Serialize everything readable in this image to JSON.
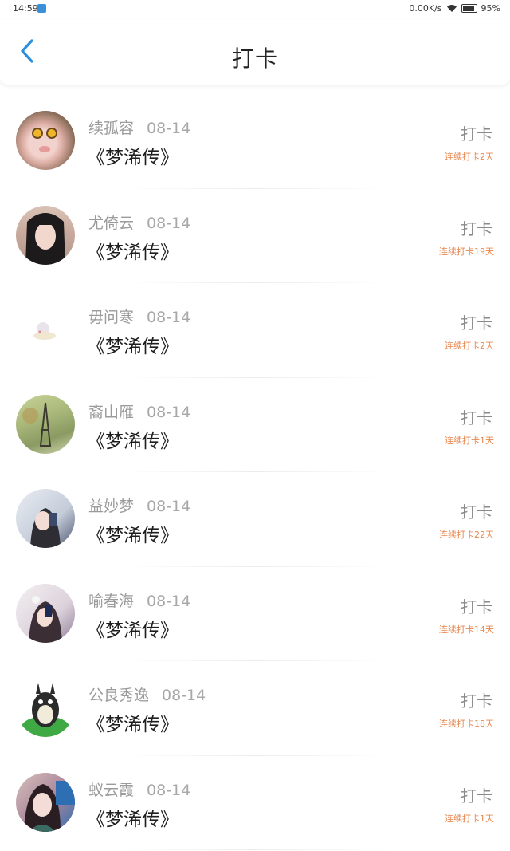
{
  "status_bar": {
    "time": "14:59",
    "network_speed": "0.00K/s",
    "battery": "95%",
    "icons": [
      "app-notification-icon",
      "wifi-icon",
      "battery-icon"
    ]
  },
  "header": {
    "title": "打卡",
    "back_icon": "chevron-left-icon",
    "accent_color": "#2b8fe0"
  },
  "checkin_list": [
    {
      "name": "续孤容",
      "date": "08-14",
      "book": "《梦浠传》",
      "action": "打卡",
      "streak": "连续打卡2天"
    },
    {
      "name": "尤倚云",
      "date": "08-14",
      "book": "《梦浠传》",
      "action": "打卡",
      "streak": "连续打卡19天"
    },
    {
      "name": "毋问寒",
      "date": "08-14",
      "book": "《梦浠传》",
      "action": "打卡",
      "streak": "连续打卡2天"
    },
    {
      "name": "裔山雁",
      "date": "08-14",
      "book": "《梦浠传》",
      "action": "打卡",
      "streak": "连续打卡1天"
    },
    {
      "name": "益妙梦",
      "date": "08-14",
      "book": "《梦浠传》",
      "action": "打卡",
      "streak": "连续打卡22天"
    },
    {
      "name": "喻春海",
      "date": "08-14",
      "book": "《梦浠传》",
      "action": "打卡",
      "streak": "连续打卡14天"
    },
    {
      "name": "公良秀逸",
      "date": "08-14",
      "book": "《梦浠传》",
      "action": "打卡",
      "streak": "连续打卡18天"
    },
    {
      "name": "蚁云霞",
      "date": "08-14",
      "book": "《梦浠传》",
      "action": "打卡",
      "streak": "连续打卡1天"
    }
  ],
  "colors": {
    "streak_text": "#e8864c",
    "name_text": "#9b9b9b",
    "book_text": "#1e1e1e"
  }
}
